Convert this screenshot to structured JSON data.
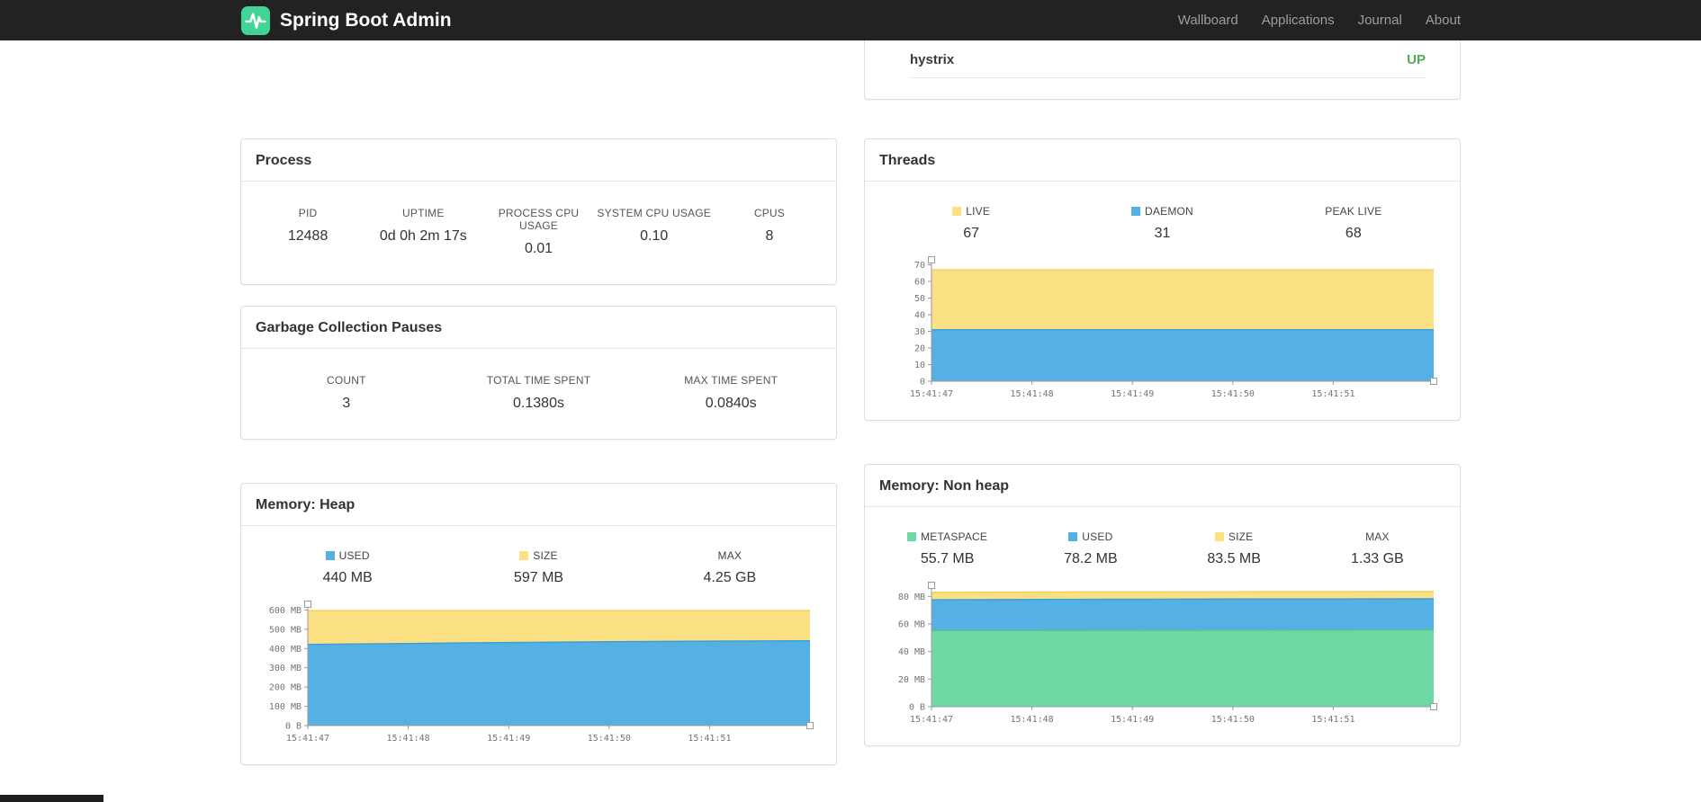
{
  "colors": {
    "navbar_bg": "#222222",
    "brand_green": "#42d396",
    "status_up": "#4caf50",
    "series_blue": "#55b1e4",
    "series_yellow": "#fbe183",
    "series_green": "#6fd9a6"
  },
  "navbar": {
    "brand": "Spring Boot Admin",
    "items": [
      {
        "label": "Wallboard"
      },
      {
        "label": "Applications"
      },
      {
        "label": "Journal"
      },
      {
        "label": "About"
      }
    ]
  },
  "health": {
    "service": "hystrix",
    "status": "UP"
  },
  "process": {
    "title": "Process",
    "stats": [
      {
        "label": "PID",
        "value": "12488"
      },
      {
        "label": "UPTIME",
        "value": "0d 0h 2m 17s"
      },
      {
        "label": "PROCESS CPU USAGE",
        "value": "0.01"
      },
      {
        "label": "SYSTEM CPU USAGE",
        "value": "0.10"
      },
      {
        "label": "CPUS",
        "value": "8"
      }
    ]
  },
  "gc": {
    "title": "Garbage Collection Pauses",
    "stats": [
      {
        "label": "COUNT",
        "value": "3"
      },
      {
        "label": "TOTAL TIME SPENT",
        "value": "0.1380s"
      },
      {
        "label": "MAX TIME SPENT",
        "value": "0.0840s"
      }
    ]
  },
  "threads": {
    "title": "Threads",
    "legend": [
      {
        "label": "LIVE",
        "value": "67",
        "color": "#fbe183"
      },
      {
        "label": "DAEMON",
        "value": "31",
        "color": "#55b1e4"
      },
      {
        "label": "PEAK LIVE",
        "value": "68",
        "color": null
      }
    ]
  },
  "memory_heap": {
    "title": "Memory: Heap",
    "legend": [
      {
        "label": "USED",
        "value": "440 MB",
        "color": "#55b1e4"
      },
      {
        "label": "SIZE",
        "value": "597 MB",
        "color": "#fbe183"
      },
      {
        "label": "MAX",
        "value": "4.25 GB",
        "color": null
      }
    ]
  },
  "memory_nonheap": {
    "title": "Memory: Non heap",
    "legend": [
      {
        "label": "METASPACE",
        "value": "55.7 MB",
        "color": "#6fd9a6"
      },
      {
        "label": "USED",
        "value": "78.2 MB",
        "color": "#55b1e4"
      },
      {
        "label": "SIZE",
        "value": "83.5 MB",
        "color": "#fbe183"
      },
      {
        "label": "MAX",
        "value": "1.33 GB",
        "color": null
      }
    ]
  },
  "chart_data": [
    {
      "id": "threads-chart",
      "type": "area",
      "title": "Threads",
      "x": [
        "15:41:47",
        "15:41:48",
        "15:41:49",
        "15:41:50",
        "15:41:51"
      ],
      "ylim": [
        0,
        73
      ],
      "yticks": [
        {
          "v": 0,
          "label": "0"
        },
        {
          "v": 10,
          "label": "10"
        },
        {
          "v": 20,
          "label": "20"
        },
        {
          "v": 30,
          "label": "30"
        },
        {
          "v": 40,
          "label": "40"
        },
        {
          "v": 50,
          "label": "50"
        },
        {
          "v": 60,
          "label": "60"
        },
        {
          "v": 70,
          "label": "70"
        }
      ],
      "series": [
        {
          "name": "LIVE",
          "color": "#fbe183",
          "line": "#f2d061",
          "values": [
            67,
            67,
            67,
            67,
            67,
            67
          ]
        },
        {
          "name": "DAEMON",
          "color": "#55b1e4",
          "line": "#3d9fd6",
          "values": [
            31,
            31,
            31,
            31,
            31,
            31
          ]
        }
      ]
    },
    {
      "id": "heap-chart",
      "type": "area",
      "title": "Memory: Heap",
      "x": [
        "15:41:47",
        "15:41:48",
        "15:41:49",
        "15:41:50",
        "15:41:51"
      ],
      "ylim": [
        0,
        630
      ],
      "yticks": [
        {
          "v": 0,
          "label": "0 B"
        },
        {
          "v": 100,
          "label": "100 MB"
        },
        {
          "v": 200,
          "label": "200 MB"
        },
        {
          "v": 300,
          "label": "300 MB"
        },
        {
          "v": 400,
          "label": "400 MB"
        },
        {
          "v": 500,
          "label": "500 MB"
        },
        {
          "v": 600,
          "label": "600 MB"
        }
      ],
      "series": [
        {
          "name": "SIZE",
          "color": "#fbe183",
          "line": "#f2d061",
          "values": [
            597,
            597,
            597,
            597,
            597,
            597
          ]
        },
        {
          "name": "USED",
          "color": "#55b1e4",
          "line": "#3d9fd6",
          "values": [
            421,
            426,
            431,
            435,
            438,
            440
          ]
        }
      ]
    },
    {
      "id": "nonheap-chart",
      "type": "area",
      "title": "Memory: Non heap",
      "x": [
        "15:41:47",
        "15:41:48",
        "15:41:49",
        "15:41:50",
        "15:41:51"
      ],
      "ylim": [
        0,
        88
      ],
      "yticks": [
        {
          "v": 0,
          "label": "0 B"
        },
        {
          "v": 20,
          "label": "20 MB"
        },
        {
          "v": 40,
          "label": "40 MB"
        },
        {
          "v": 60,
          "label": "60 MB"
        },
        {
          "v": 80,
          "label": "80 MB"
        }
      ],
      "series": [
        {
          "name": "SIZE",
          "color": "#fbe183",
          "line": "#f2d061",
          "values": [
            83.0,
            83.1,
            83.2,
            83.3,
            83.4,
            83.5
          ]
        },
        {
          "name": "USED",
          "color": "#55b1e4",
          "line": "#3d9fd6",
          "values": [
            77.5,
            77.7,
            77.9,
            78.0,
            78.1,
            78.2
          ]
        },
        {
          "name": "METASPACE",
          "color": "#6fd9a6",
          "line": "#4fc791",
          "values": [
            55.2,
            55.3,
            55.4,
            55.5,
            55.6,
            55.7
          ]
        }
      ]
    }
  ]
}
